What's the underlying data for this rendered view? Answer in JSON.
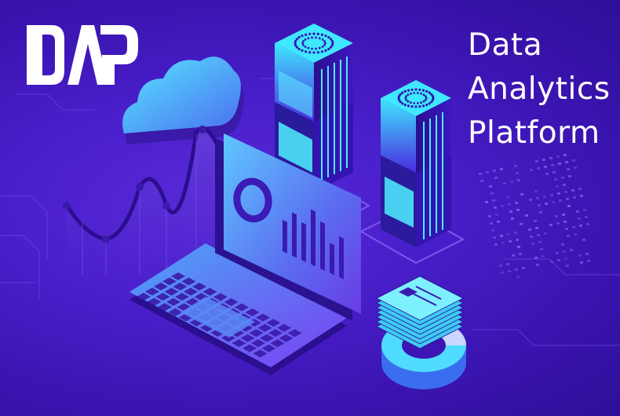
{
  "logo": {
    "text": "DAP",
    "color": "#ffffff"
  },
  "title": {
    "lines": [
      "Data",
      "Analytics",
      "Platform"
    ],
    "color": "#ffffff"
  },
  "palette": {
    "background": "#4a1fcc",
    "cyan": "#3fe0ff",
    "violet": "#7a3cf0"
  },
  "illustration": {
    "objects": [
      "cloud",
      "line-chart",
      "laptop",
      "server-towers",
      "document-stack",
      "donut-chart",
      "dot-matrix"
    ]
  }
}
